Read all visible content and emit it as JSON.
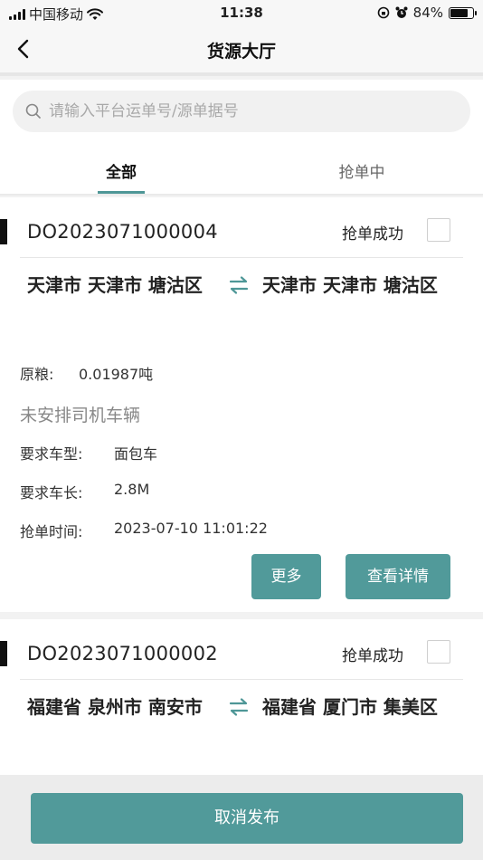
{
  "status_bar": {
    "carrier": "中国移动",
    "time": "11:38",
    "battery": "84%",
    "battery_level": 0.84
  },
  "nav": {
    "title": "货源大厅"
  },
  "search": {
    "placeholder": "请输入平台运单号/源单据号",
    "value": ""
  },
  "tabs": [
    {
      "label": "全部",
      "active": true
    },
    {
      "label": "抢单中",
      "active": false
    }
  ],
  "orders": [
    {
      "order_no": "DO2023071000004",
      "status": "抢单成功",
      "from": "天津市 天津市 塘沽区",
      "to": "天津市 天津市 塘沽区",
      "cargo_label": "原粮:",
      "cargo_value": "0.01987吨",
      "note": "未安排司机车辆",
      "vehicle_type_label": "要求车型:",
      "vehicle_type": "面包车",
      "vehicle_length_label": "要求车长:",
      "vehicle_length": "2.8M",
      "grab_time_label": "抢单时间:",
      "grab_time": "2023-07-10 11:01:22",
      "more_label": "更多",
      "detail_label": "查看详情"
    },
    {
      "order_no": "DO2023071000002",
      "status": "抢单成功",
      "from": "福建省 泉州市 南安市",
      "to": "福建省 厦门市 集美区"
    }
  ],
  "footer": {
    "cancel_label": "取消发布"
  },
  "colors": {
    "accent": "#519a9a",
    "tab_indicator": "#4e9797"
  }
}
